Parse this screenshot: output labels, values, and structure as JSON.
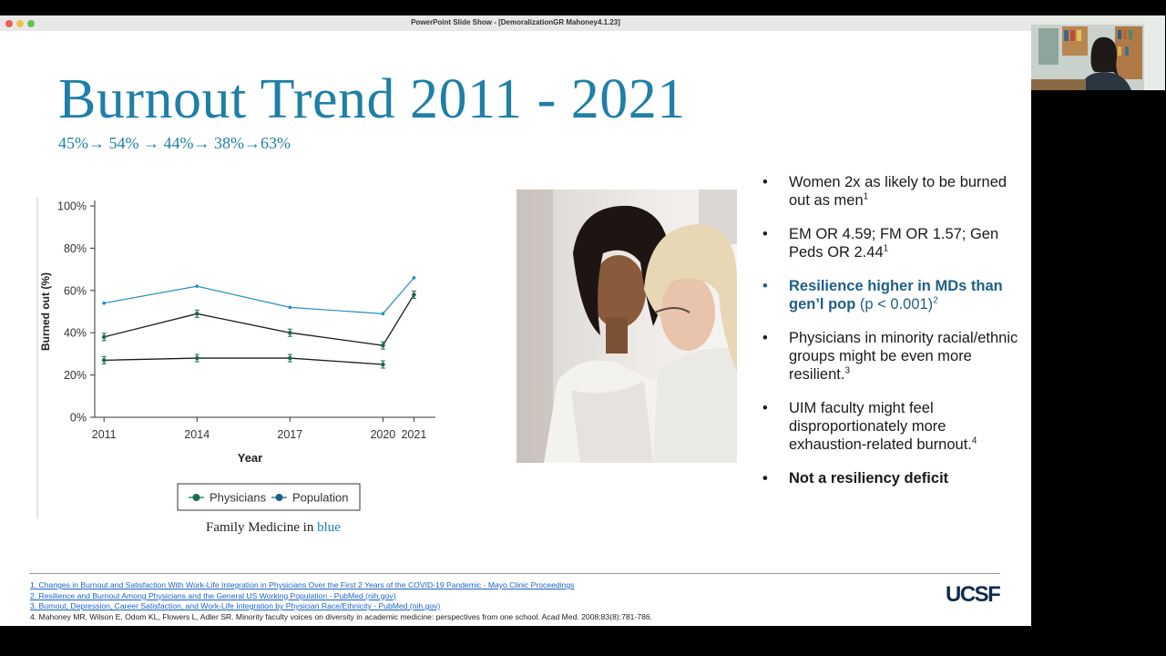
{
  "window": {
    "title": "PowerPoint Slide Show - [DemoralizationGR Mahoney4.1.23]"
  },
  "slide": {
    "title": "Burnout Trend 2011 - 2021",
    "subtitle": "45%→ 54% → 44%→ 38%→63%",
    "caption_prefix": "Family Medicine in ",
    "caption_highlight": "blue",
    "bullets": [
      {
        "text": "Women 2x as likely to be burned out as men",
        "sup": "1"
      },
      {
        "text": "EM OR 4.59; FM OR 1.57; Gen Peds OR 2.44",
        "sup": "1"
      },
      {
        "bold": "Resilience higher in MDs than gen’l pop",
        "text": " (p < 0.001)",
        "sup": "2"
      },
      {
        "text": "Physicians in minority racial/ethnic groups might be even more resilient.",
        "sup": "3"
      },
      {
        "text": "UIM faculty might feel disproportionately more exhaustion-related burnout.",
        "sup": "4"
      },
      {
        "text": "Not a resiliency deficit"
      }
    ],
    "references": [
      "1. Changes in Burnout and Satisfaction With Work-Life Integration in Physicians Over the First 2 Years of the COVID-19 Pandemic - Mayo Clinic Proceedings",
      "2. Resilience and Burnout Among Physicians and the General US Working Population - PubMed (nih.gov)",
      "3. Burnout, Depression, Career Satisfaction, and Work-Life Integration by Physician Race/Ethnicity - PubMed (nih.gov)",
      "4. Mahoney  MR, Wilson  E, Odom  KL, Flowers  L, Adler  SR.  Minority faculty voices on diversity in academic medicine: perspectives from one school.   Acad Med. 2008;83(8):781-786."
    ],
    "logo": "UCSF"
  },
  "chart_data": {
    "type": "line",
    "x": [
      2011,
      2014,
      2017,
      2020,
      2021
    ],
    "x_tick_labels": [
      "2011",
      "2014",
      "2017",
      "2020",
      "2021"
    ],
    "y_tick_labels": [
      "0%",
      "20%",
      "40%",
      "60%",
      "80%",
      "100%"
    ],
    "ylim": [
      0,
      100
    ],
    "xlabel": "Year",
    "ylabel": "Burned out (%)",
    "legend": [
      "Physicians",
      "Population"
    ],
    "legend_position": "bottom",
    "series": [
      {
        "values": [
          54,
          62,
          52,
          49,
          66
        ],
        "color": "#2a8fbe",
        "markers": "dot"
      },
      {
        "values": [
          38,
          49,
          40,
          34,
          58
        ],
        "color": "#1c1c1c",
        "markers": "errorbar"
      },
      {
        "values": [
          27,
          28,
          28,
          25,
          null
        ],
        "color": "#1c1c1c",
        "markers": "errorbar"
      }
    ],
    "legend_colors": {
      "physicians": "#1b6b52",
      "population": "#1e5f8a"
    }
  }
}
